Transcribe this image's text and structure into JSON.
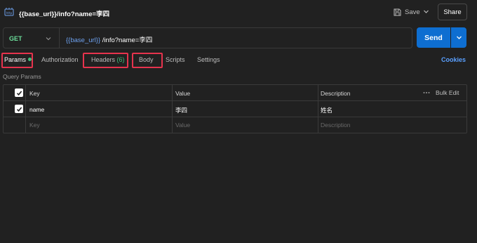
{
  "request": {
    "name": "{{base_url}}/info?name=李四",
    "method": "GET",
    "url_variable": "{{base_url}}",
    "url_path": "/info?name=李四"
  },
  "header": {
    "save_label": "Save",
    "share_label": "Share"
  },
  "send_label": "Send",
  "tabs": [
    {
      "label": "Params",
      "active": true,
      "indicator": "green-dot"
    },
    {
      "label": "Authorization"
    },
    {
      "label": "Headers",
      "count": "(6)"
    },
    {
      "label": "Body"
    },
    {
      "label": "Scripts"
    },
    {
      "label": "Settings"
    }
  ],
  "cookies_label": "Cookies",
  "query_params": {
    "label": "Query Params",
    "columns": [
      "Key",
      "Value",
      "Description"
    ],
    "bulk_edit_label": "Bulk Edit",
    "rows": [
      {
        "checked": true,
        "key": "name",
        "value": "李四",
        "description": "姓名"
      }
    ],
    "placeholder": {
      "key": "Key",
      "value": "Value",
      "description": "Description"
    }
  },
  "colors": {
    "background": "#212121",
    "method_get": "#6bdd9a",
    "accent_blue": "#0e6ed1",
    "link_blue": "#5aa0ff",
    "url_variable": "#6ea2f0",
    "active_green": "#3cc47c",
    "highlight_red": "#e6334d"
  },
  "icons": [
    "http-request-icon",
    "save-icon",
    "chevron-down-icon",
    "dots-icon",
    "checkmark-icon"
  ]
}
